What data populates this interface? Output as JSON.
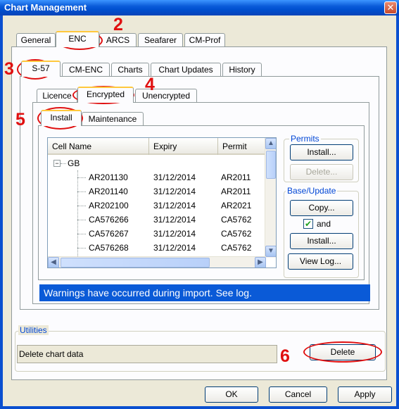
{
  "window": {
    "title": "Chart Management",
    "close_glyph": "✕"
  },
  "tabs_top": [
    "General",
    "ENC",
    "ARCS",
    "Seafarer",
    "CM-Prof"
  ],
  "tabs_enc": [
    "S-57",
    "CM-ENC",
    "Charts",
    "Chart Updates",
    "History"
  ],
  "tabs_s57": [
    "Licence",
    "Encrypted",
    "Unencrypted"
  ],
  "tabs_encrypted": [
    "Install",
    "Maintenance"
  ],
  "list": {
    "columns": [
      "Cell Name",
      "Expiry",
      "Permit"
    ],
    "group": "GB",
    "group_toggle": "−",
    "rows": [
      {
        "name": "AR201130",
        "expiry": "31/12/2014",
        "permit": "AR2011"
      },
      {
        "name": "AR201140",
        "expiry": "31/12/2014",
        "permit": "AR2011"
      },
      {
        "name": "AR202100",
        "expiry": "31/12/2014",
        "permit": "AR2021"
      },
      {
        "name": "CA576266",
        "expiry": "31/12/2014",
        "permit": "CA5762"
      },
      {
        "name": "CA576267",
        "expiry": "31/12/2014",
        "permit": "CA5762"
      },
      {
        "name": "CA576268",
        "expiry": "31/12/2014",
        "permit": "CA5762"
      }
    ]
  },
  "permits": {
    "title": "Permits",
    "install": "Install...",
    "delete": "Delete..."
  },
  "base_update": {
    "title": "Base/Update",
    "copy": "Copy...",
    "and_label": "and",
    "and_checked": true,
    "install": "Install...",
    "view_log": "View Log..."
  },
  "warning": "Warnings have occurred during import. See log.",
  "utilities": {
    "title": "Utilities",
    "label": "Delete chart data",
    "delete": "Delete"
  },
  "footer": {
    "ok": "OK",
    "cancel": "Cancel",
    "apply": "Apply"
  },
  "annotations": [
    "2",
    "3",
    "4",
    "5",
    "6"
  ],
  "colors": {
    "titlebar": "#0050d0",
    "warning_bg": "#0a5ad7",
    "annotation": "#e01010",
    "tab_highlight": "#ffc83c"
  }
}
